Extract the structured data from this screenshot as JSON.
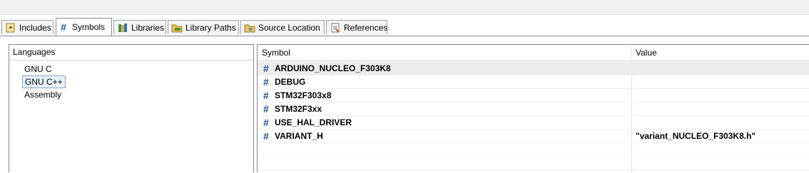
{
  "tabs": [
    {
      "label": "Includes",
      "icon": "includes-icon",
      "active": false
    },
    {
      "label": "Symbols",
      "icon": "hash-icon",
      "active": true
    },
    {
      "label": "Libraries",
      "icon": "libraries-icon",
      "active": false
    },
    {
      "label": "Library Paths",
      "icon": "library-paths-icon",
      "active": false
    },
    {
      "label": "Source Location",
      "icon": "source-location-icon",
      "active": false
    },
    {
      "label": "References",
      "icon": "references-icon",
      "active": false
    }
  ],
  "languages": {
    "header": "Languages",
    "items": [
      {
        "label": "GNU C",
        "selected": false
      },
      {
        "label": "GNU C++",
        "selected": true
      },
      {
        "label": "Assembly",
        "selected": false
      }
    ]
  },
  "symbols": {
    "columns": {
      "symbol": "Symbol",
      "value": "Value"
    },
    "hash_glyph": "#",
    "rows": [
      {
        "name": "ARDUINO_NUCLEO_F303K8",
        "value": ""
      },
      {
        "name": "DEBUG",
        "value": ""
      },
      {
        "name": "STM32F303x8",
        "value": ""
      },
      {
        "name": "STM32F3xx",
        "value": ""
      },
      {
        "name": "USE_HAL_DRIVER",
        "value": ""
      },
      {
        "name": "VARIANT_H",
        "value": "\"variant_NUCLEO_F303K8.h\""
      }
    ]
  }
}
